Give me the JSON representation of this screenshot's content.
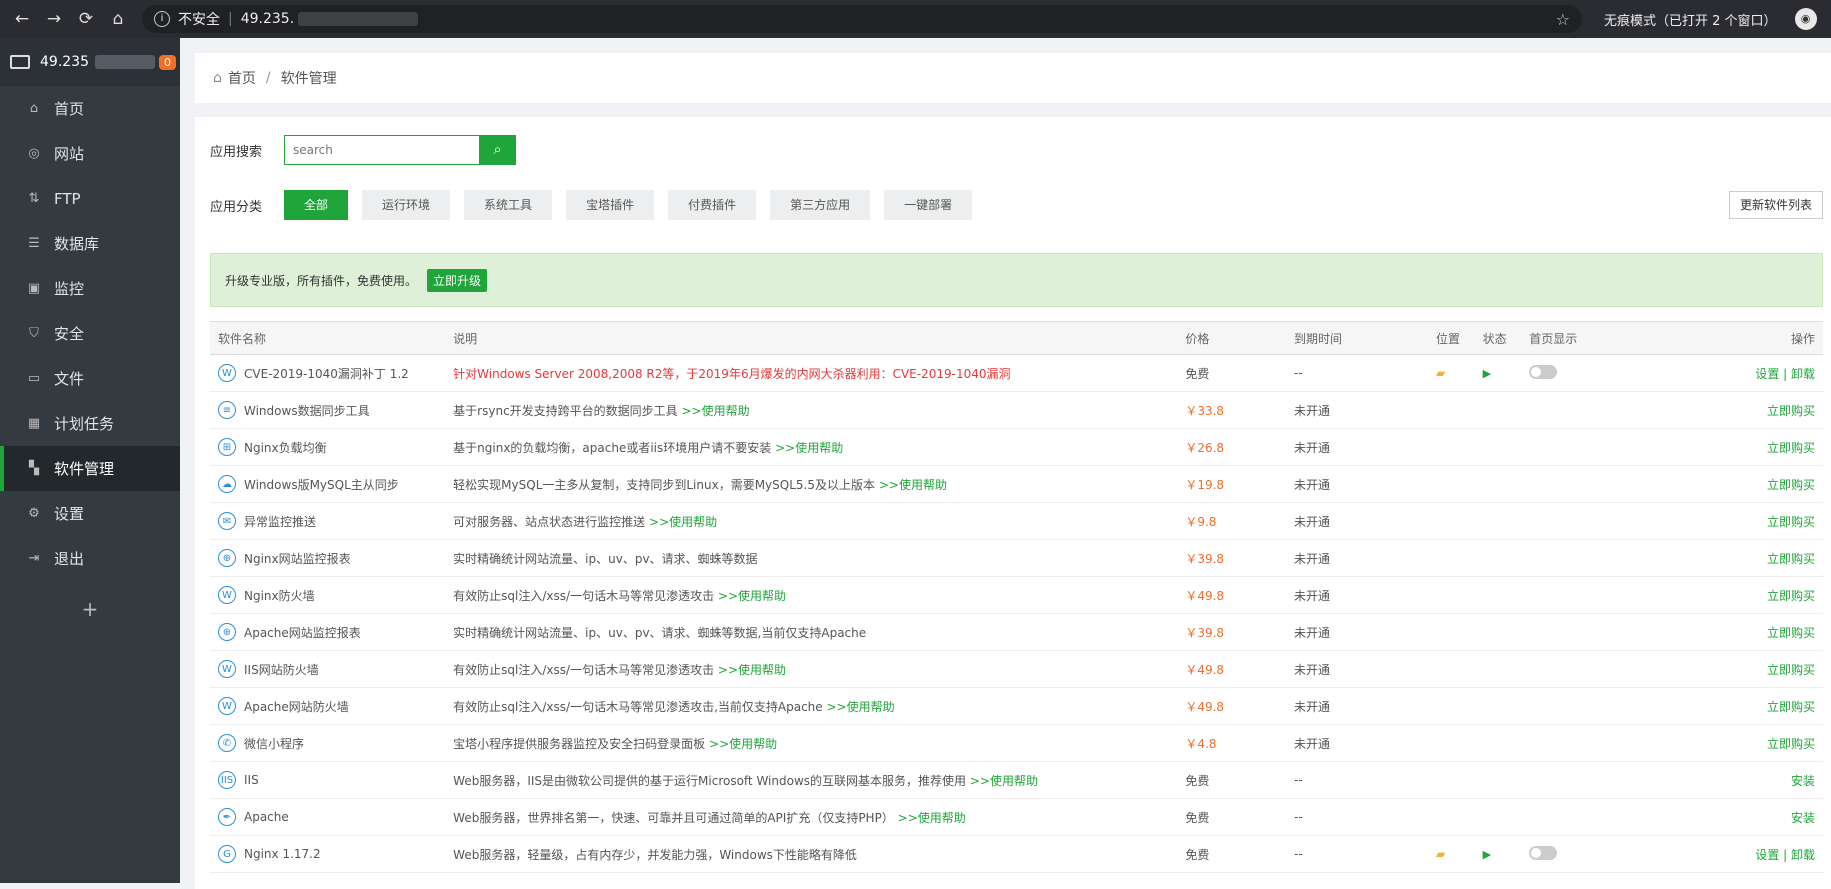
{
  "browser": {
    "address": "49.235.",
    "security": "不安全",
    "incognito": "无痕模式（已打开 2 个窗口）"
  },
  "sidebar": {
    "server": "49.235",
    "badge": "0",
    "items": [
      {
        "label": "首页",
        "icon": "home-icon"
      },
      {
        "label": "网站",
        "icon": "globe-icon"
      },
      {
        "label": "FTP",
        "icon": "ftp-icon"
      },
      {
        "label": "数据库",
        "icon": "database-icon"
      },
      {
        "label": "监控",
        "icon": "monitor-icon"
      },
      {
        "label": "安全",
        "icon": "shield-icon"
      },
      {
        "label": "文件",
        "icon": "folder-icon"
      },
      {
        "label": "计划任务",
        "icon": "calendar-icon"
      },
      {
        "label": "软件管理",
        "icon": "grid-icon"
      },
      {
        "label": "设置",
        "icon": "gear-icon"
      },
      {
        "label": "退出",
        "icon": "logout-icon"
      }
    ],
    "add": "+"
  },
  "breadcrumb": {
    "home": "首页",
    "current": "软件管理"
  },
  "search": {
    "label": "应用搜索",
    "placeholder": "search"
  },
  "categories": {
    "label": "应用分类",
    "items": [
      "全部",
      "运行环境",
      "系统工具",
      "宝塔插件",
      "付费插件",
      "第三方应用",
      "一键部署"
    ],
    "update": "更新软件列表"
  },
  "promo": {
    "text": "升级专业版，所有插件，免费使用。",
    "button": "立即升级"
  },
  "table": {
    "headers": [
      "软件名称",
      "说明",
      "价格",
      "到期时间",
      "位置",
      "状态",
      "首页显示",
      "操作"
    ],
    "rows": [
      {
        "name": "CVE-2019-1040漏洞补丁 1.2",
        "desc": "针对Windows Server 2008,2008 R2等，于2019年6月爆发的内网大杀器利用：CVE-2019-1040漏洞",
        "help": "",
        "price": "免费",
        "expire": "--",
        "op": "设置 | 卸载"
      },
      {
        "name": "Windows数据同步工具",
        "desc": "基于rsync开发支持跨平台的数据同步工具",
        "help": ">>使用帮助",
        "price": "￥33.8",
        "expire": "未开通",
        "op": "立即购买"
      },
      {
        "name": "Nginx负载均衡",
        "desc": "基于nginx的负载均衡，apache或者iis环境用户请不要安装",
        "help": ">>使用帮助",
        "price": "￥26.8",
        "expire": "未开通",
        "op": "立即购买"
      },
      {
        "name": "Windows版MySQL主从同步",
        "desc": "轻松实现MySQL一主多从复制，支持同步到Linux，需要MySQL5.5及以上版本",
        "help": ">>使用帮助",
        "price": "￥19.8",
        "expire": "未开通",
        "op": "立即购买"
      },
      {
        "name": "异常监控推送",
        "desc": "可对服务器、站点状态进行监控推送",
        "help": ">>使用帮助",
        "price": "￥9.8",
        "expire": "未开通",
        "op": "立即购买"
      },
      {
        "name": "Nginx网站监控报表",
        "desc": "实时精确统计网站流量、ip、uv、pv、请求、蜘蛛等数据",
        "help": "",
        "price": "￥39.8",
        "expire": "未开通",
        "op": "立即购买"
      },
      {
        "name": "Nginx防火墙",
        "desc": "有效防止sql注入/xss/一句话木马等常见渗透攻击",
        "help": ">>使用帮助",
        "price": "￥49.8",
        "expire": "未开通",
        "op": "立即购买"
      },
      {
        "name": "Apache网站监控报表",
        "desc": "实时精确统计网站流量、ip、uv、pv、请求、蜘蛛等数据,当前仅支持Apache",
        "help": "",
        "price": "￥39.8",
        "expire": "未开通",
        "op": "立即购买"
      },
      {
        "name": "IIS网站防火墙",
        "desc": "有效防止sql注入/xss/一句话木马等常见渗透攻击",
        "help": ">>使用帮助",
        "price": "￥49.8",
        "expire": "未开通",
        "op": "立即购买"
      },
      {
        "name": "Apache网站防火墙",
        "desc": "有效防止sql注入/xss/一句话木马等常见渗透攻击,当前仅支持Apache",
        "help": ">>使用帮助",
        "price": "￥49.8",
        "expire": "未开通",
        "op": "立即购买"
      },
      {
        "name": "微信小程序",
        "desc": "宝塔小程序提供服务器监控及安全扫码登录面板",
        "help": ">>使用帮助",
        "price": "￥4.8",
        "expire": "未开通",
        "op": "立即购买"
      },
      {
        "name": "IIS",
        "desc": "Web服务器，IIS是由微软公司提供的基于运行Microsoft Windows的互联网基本服务，推荐使用",
        "help": ">>使用帮助",
        "price": "免费",
        "expire": "--",
        "op": "安装"
      },
      {
        "name": "Apache",
        "desc": "Web服务器，世界排名第一，快速、可靠并且可通过简单的API扩充（仅支持PHP）",
        "help": ">>使用帮助",
        "price": "免费",
        "expire": "--",
        "op": "安装"
      },
      {
        "name": "Nginx 1.17.2",
        "desc": "Web服务器，轻量级，占有内存少，并发能力强，Windows下性能略有降低",
        "help": "",
        "price": "免费",
        "expire": "--",
        "op": "设置 | 卸载"
      }
    ]
  },
  "icons": [
    "waf-icon",
    "database-sync-icon",
    "network-icon",
    "cloud-sync-icon",
    "mail-icon",
    "chart-globe-icon",
    "waf-icon",
    "chart-globe-icon",
    "waf-icon",
    "waf-icon",
    "wechat-icon",
    "iis-icon",
    "apache-feather-icon",
    "nginx-icon"
  ]
}
